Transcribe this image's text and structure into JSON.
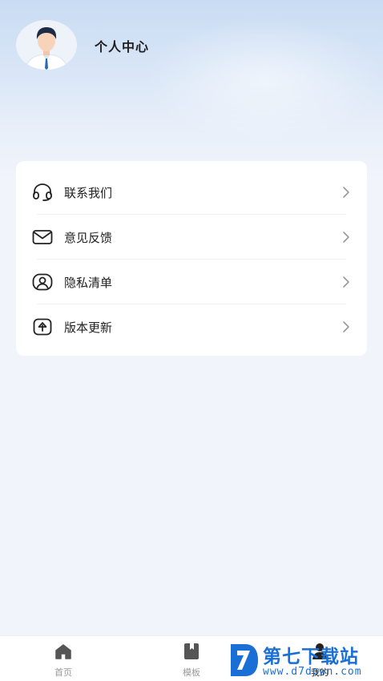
{
  "profile": {
    "title": "个人中心",
    "avatar_icon": "businessman-avatar-icon"
  },
  "menu": [
    {
      "label": "联系我们",
      "icon": "headset-icon"
    },
    {
      "label": "意见反馈",
      "icon": "mail-icon"
    },
    {
      "label": "隐私清单",
      "icon": "privacy-user-icon"
    },
    {
      "label": "版本更新",
      "icon": "upload-icon"
    }
  ],
  "tabbar": {
    "tabs": [
      {
        "label": "首页",
        "icon": "home-icon"
      },
      {
        "label": "模板",
        "icon": "bookmark-icon"
      },
      {
        "label": "我的",
        "icon": "user-icon",
        "active": true
      }
    ]
  },
  "watermark": {
    "title": "第七下载站",
    "url": "www.d7down.com"
  },
  "colors": {
    "accent": "#1a6fd6",
    "background": "#f2f4fb",
    "card": "#ffffff"
  }
}
